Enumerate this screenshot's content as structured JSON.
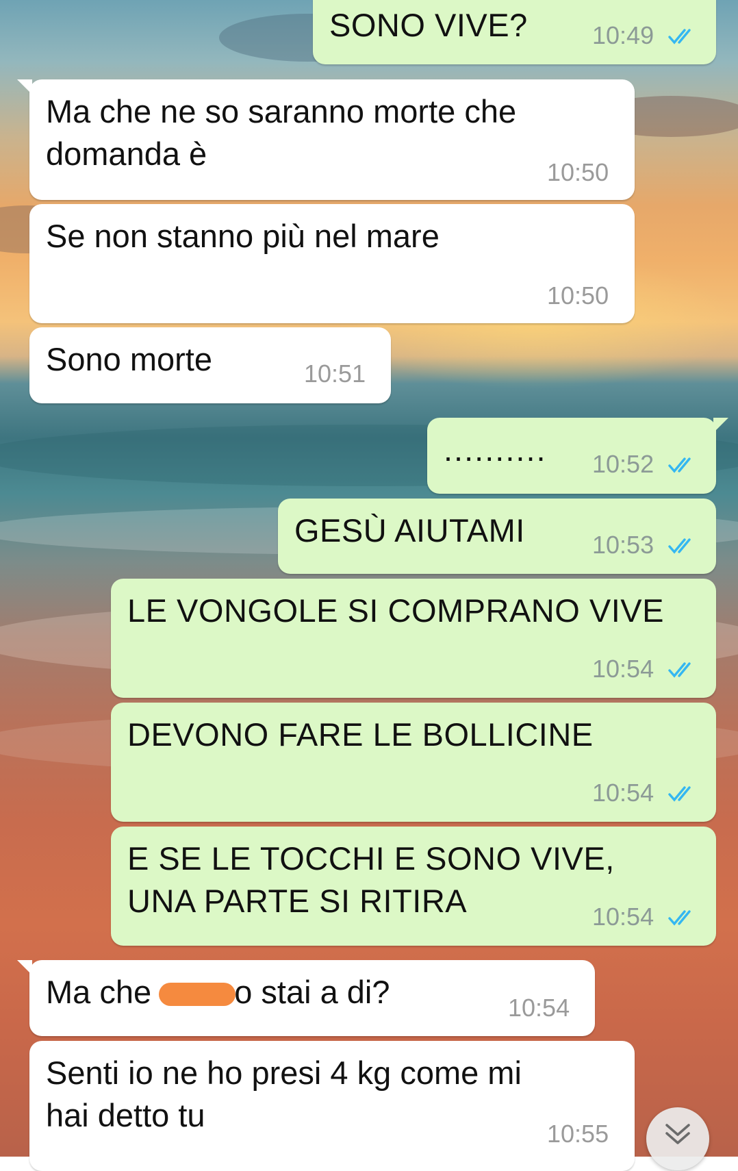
{
  "chat": {
    "messages": [
      {
        "id": "m1",
        "direction": "outgoing",
        "text": "SONO VIVE?",
        "time": "10:49",
        "status": "read"
      },
      {
        "id": "m2",
        "direction": "incoming",
        "text": "Ma che ne so saranno morte che\ndomanda è",
        "time": "10:50"
      },
      {
        "id": "m3",
        "direction": "incoming",
        "text": "Se non stanno più nel mare",
        "time": "10:50"
      },
      {
        "id": "m4",
        "direction": "incoming",
        "text": "Sono morte",
        "time": "10:51"
      },
      {
        "id": "m5",
        "direction": "outgoing",
        "text": "..........",
        "time": "10:52",
        "status": "read"
      },
      {
        "id": "m6",
        "direction": "outgoing",
        "text": "GESÙ AIUTAMI",
        "time": "10:53",
        "status": "read"
      },
      {
        "id": "m7",
        "direction": "outgoing",
        "text": "LE VONGOLE SI COMPRANO VIVE",
        "time": "10:54",
        "status": "read"
      },
      {
        "id": "m8",
        "direction": "outgoing",
        "text": "DEVONO FARE LE BOLLICINE",
        "time": "10:54",
        "status": "read"
      },
      {
        "id": "m9",
        "direction": "outgoing",
        "text": "E SE LE TOCCHI E SONO VIVE,\nUNA PARTE SI RITIRA",
        "time": "10:54",
        "status": "read"
      },
      {
        "id": "m10",
        "direction": "incoming",
        "text_before": "Ma che ",
        "text_after": "o stai a di?",
        "redacted": true,
        "time": "10:54"
      },
      {
        "id": "m11",
        "direction": "incoming",
        "text": "Senti io ne ho presi 4 kg come mi\nhai detto tu",
        "time": "10:55"
      }
    ]
  },
  "icons": {
    "read_receipt": "double-check-icon",
    "scroll_down": "chevron-double-down-icon",
    "redaction": "censor-mark"
  },
  "colors": {
    "incoming_bubble": "#ffffff",
    "outgoing_bubble": "#dcf8c6",
    "read_tick": "#34b7f1",
    "timestamp": "#8c9a96",
    "censor": "#f58a3f"
  }
}
